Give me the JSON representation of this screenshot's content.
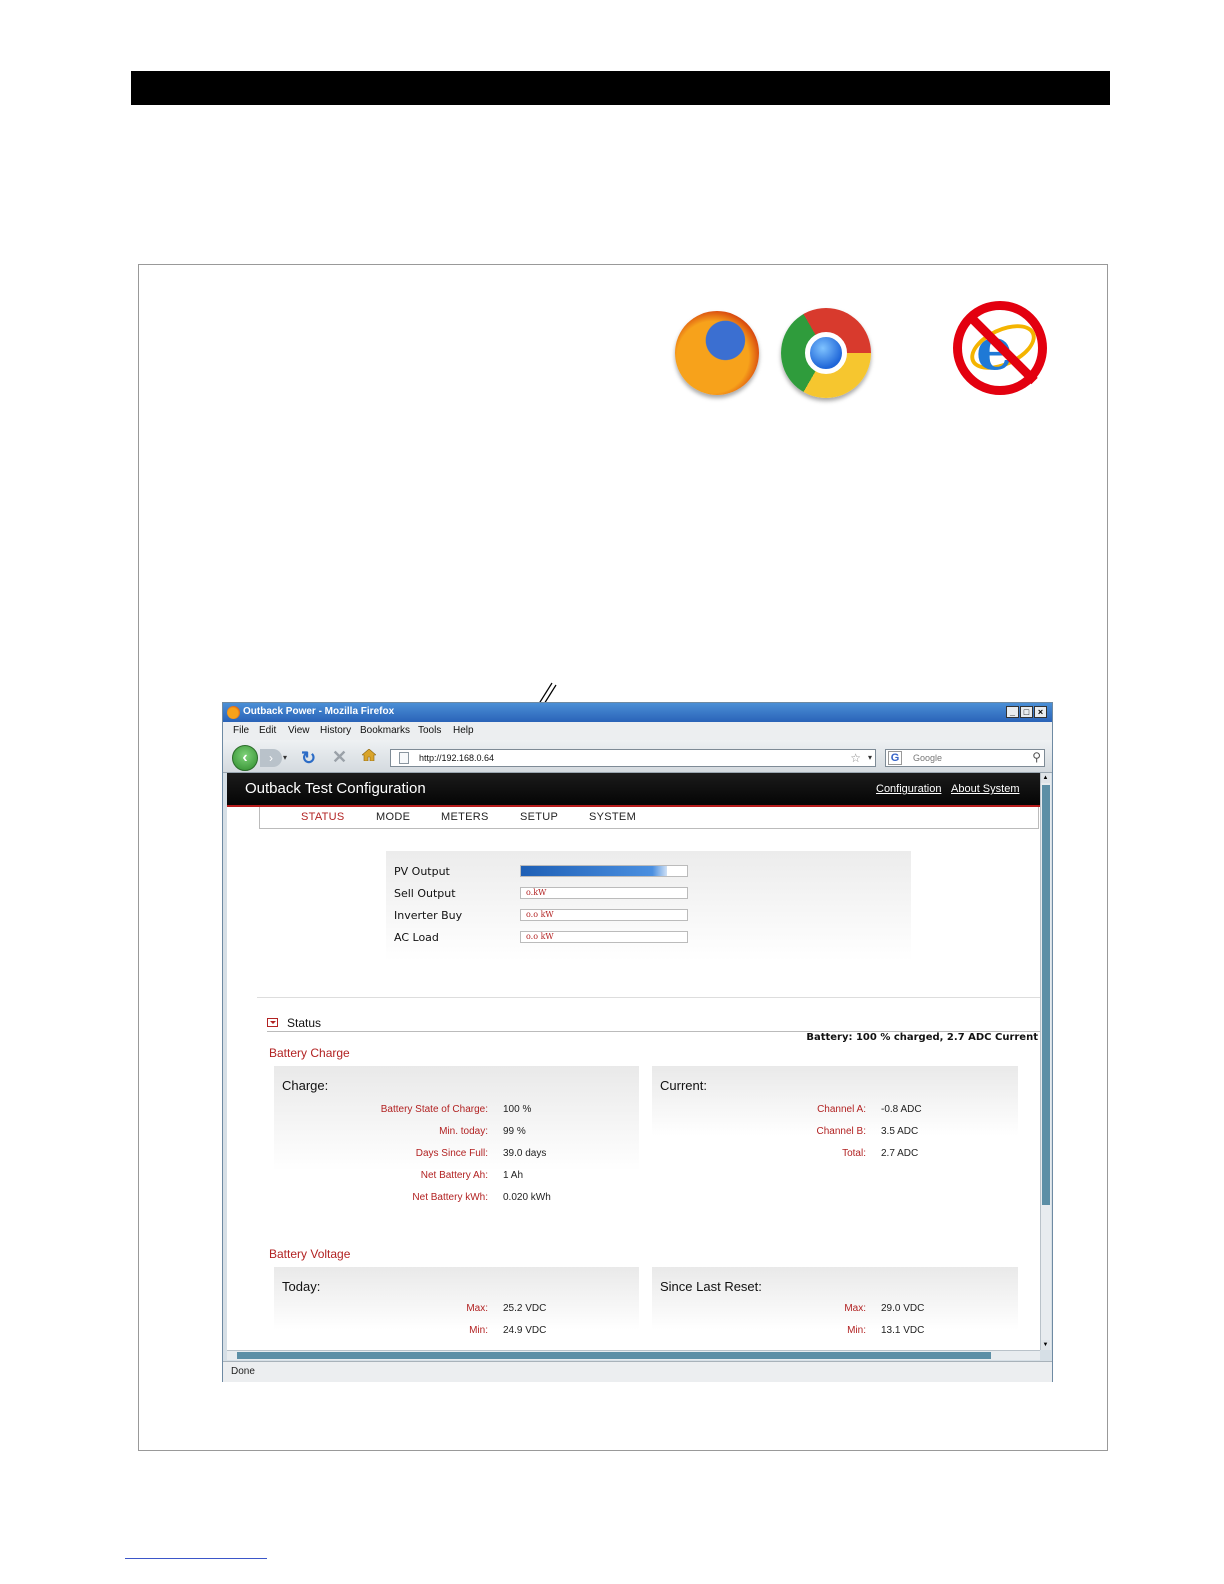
{
  "browser_window": {
    "title": "Outback Power - Mozilla Firefox",
    "controls": {
      "minimize": "_",
      "maximize": "□",
      "close": "×"
    },
    "menu": [
      "File",
      "Edit",
      "View",
      "History",
      "Bookmarks",
      "Tools",
      "Help"
    ],
    "url": "http://192.168.0.64",
    "search_placeholder": "Google",
    "status": "Done"
  },
  "app": {
    "title": "Outback Test Configuration",
    "header_links": [
      "Configuration",
      "About System"
    ],
    "tabs": [
      "STATUS",
      "MODE",
      "METERS",
      "SETUP",
      "SYSTEM"
    ],
    "active_tab": "STATUS",
    "power": [
      {
        "label": "PV Output",
        "value": "",
        "fill_fraction": 0.88
      },
      {
        "label": "Sell Output",
        "value": "o.kW"
      },
      {
        "label": "Inverter Buy",
        "value": "o.o kW"
      },
      {
        "label": "AC Load",
        "value": "o.o kW"
      }
    ],
    "status": {
      "title": "Status",
      "summary": "Battery: 100 % charged, 2.7 ADC Current",
      "battery_charge": {
        "title": "Battery Charge",
        "charge": {
          "title": "Charge:",
          "rows": [
            {
              "label": "Battery State of Charge:",
              "value": "100 %"
            },
            {
              "label": "Min. today:",
              "value": "99 %"
            },
            {
              "label": "Days Since Full:",
              "value": "39.0 days"
            },
            {
              "label": "Net Battery Ah:",
              "value": "1 Ah"
            },
            {
              "label": "Net Battery kWh:",
              "value": "0.020 kWh"
            }
          ]
        },
        "current": {
          "title": "Current:",
          "rows": [
            {
              "label": "Channel A:",
              "value": "-0.8 ADC"
            },
            {
              "label": "Channel B:",
              "value": "3.5 ADC"
            },
            {
              "label": "Total:",
              "value": "2.7 ADC"
            }
          ]
        }
      },
      "battery_voltage": {
        "title": "Battery Voltage",
        "today": {
          "title": "Today:",
          "rows": [
            {
              "label": "Max:",
              "value": "25.2 VDC"
            },
            {
              "label": "Min:",
              "value": "24.9 VDC"
            }
          ]
        },
        "since_reset": {
          "title": "Since Last Reset:",
          "rows": [
            {
              "label": "Max:",
              "value": "29.0 VDC"
            },
            {
              "label": "Min:",
              "value": "13.1 VDC"
            }
          ]
        }
      }
    }
  },
  "icons": [
    "firefox-logo",
    "chrome-logo",
    "internet-explorer-prohibited-icon"
  ],
  "colors": {
    "accent": "#b22222",
    "header": "#000000",
    "progress": "#2a6fd0"
  }
}
